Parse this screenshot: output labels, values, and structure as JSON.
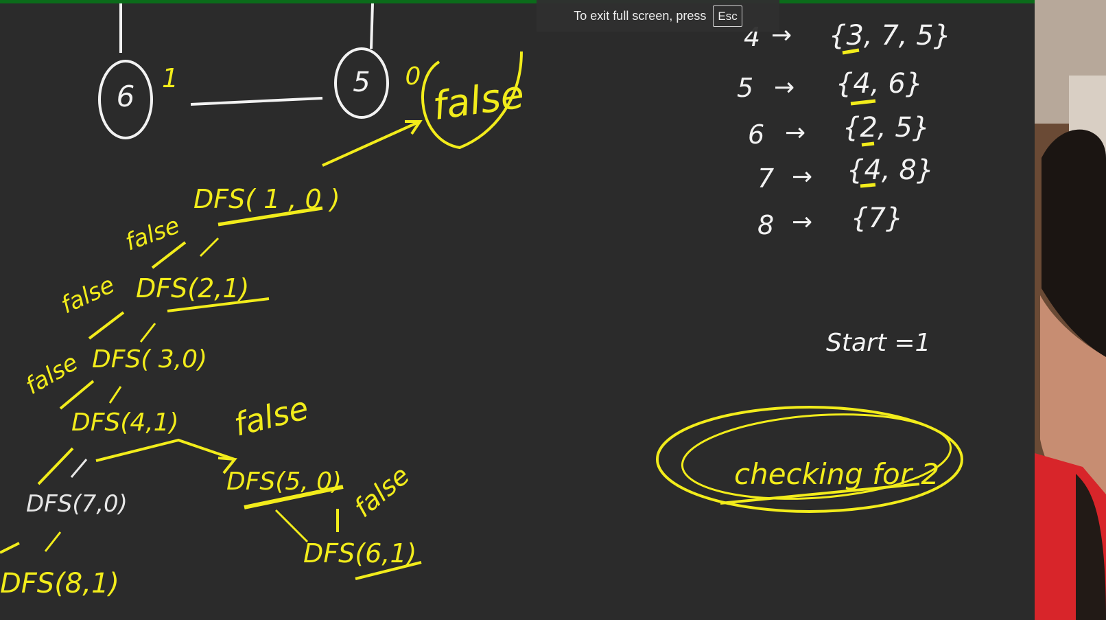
{
  "toast": {
    "message": "To exit full screen, press",
    "key": "Esc"
  },
  "graph": {
    "nodes": [
      {
        "label": "6",
        "color_tag": "1"
      },
      {
        "label": "5",
        "color_tag": "0"
      }
    ],
    "result_label": "false"
  },
  "recursion": {
    "calls": [
      {
        "text": "DFS( 1 , 0 )",
        "note": "false"
      },
      {
        "text": "DFS(2,1)",
        "note": "false"
      },
      {
        "text": "DFS( 3,0)",
        "note": "false"
      },
      {
        "text": "DFS(4,1)",
        "note": ""
      },
      {
        "text": "DFS(5, 0)",
        "note": "false"
      },
      {
        "text": "DFS(7,0)",
        "note": ""
      },
      {
        "text": "DFS(6,1)",
        "note": "false"
      },
      {
        "text": "DFS(8,1)",
        "note": ""
      }
    ],
    "extra_notes": [
      "false",
      "false"
    ]
  },
  "adjacency": [
    {
      "node": "4",
      "neighbors": "{3, 7, 5}"
    },
    {
      "node": "5",
      "neighbors": "{4, 6}"
    },
    {
      "node": "6",
      "neighbors": "{2, 5}"
    },
    {
      "node": "7",
      "neighbors": "{4, 8}"
    },
    {
      "node": "8",
      "neighbors": "{7}"
    }
  ],
  "start_label": "Start =1",
  "checking_label": "checking for 2",
  "colors": {
    "board": "#2b2b2b",
    "yellow": "#f2ec1b",
    "white": "#f2f2f2",
    "toast_bg": "#303030",
    "accent_green": "#0b6b1a"
  }
}
